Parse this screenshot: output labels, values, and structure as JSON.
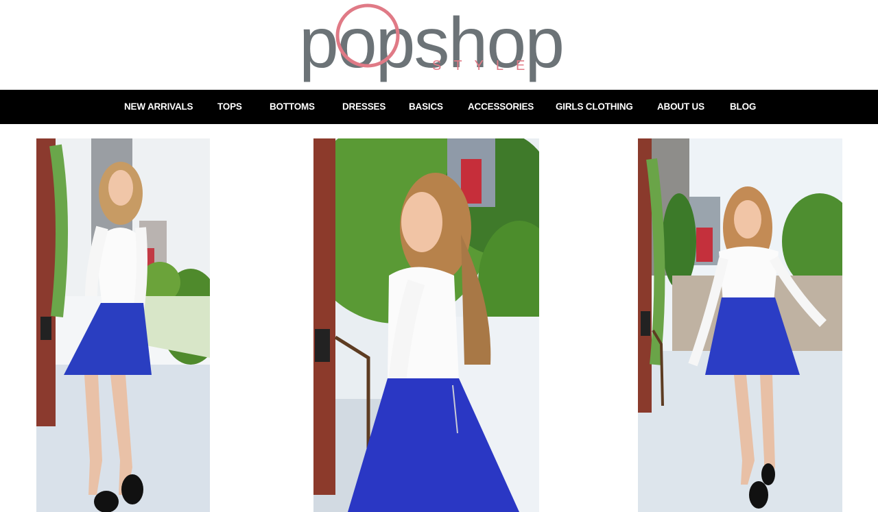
{
  "brand": {
    "logo_primary": "popshop",
    "logo_secondary": "STYLE",
    "colors": {
      "grey": "#6c7377",
      "pink": "#e07a86"
    }
  },
  "nav": {
    "background": "#000000",
    "items": [
      {
        "label": "NEW ARRIVALS"
      },
      {
        "label": "TOPS"
      },
      {
        "label": "BOTTOMS"
      },
      {
        "label": "DRESSES"
      },
      {
        "label": "BASICS"
      },
      {
        "label": "ACCESSORIES"
      },
      {
        "label": "GIRLS CLOTHING"
      },
      {
        "label": "ABOUT US"
      },
      {
        "label": "BLOG"
      }
    ]
  },
  "gallery": {
    "photos": [
      {
        "subject": "model in white long-sleeve top and blue skater skirt, side pose"
      },
      {
        "subject": "model in white long-sleeve top and blue skater skirt, looking over shoulder"
      },
      {
        "subject": "model in white long-sleeve top and blue skater skirt, walking"
      }
    ]
  }
}
